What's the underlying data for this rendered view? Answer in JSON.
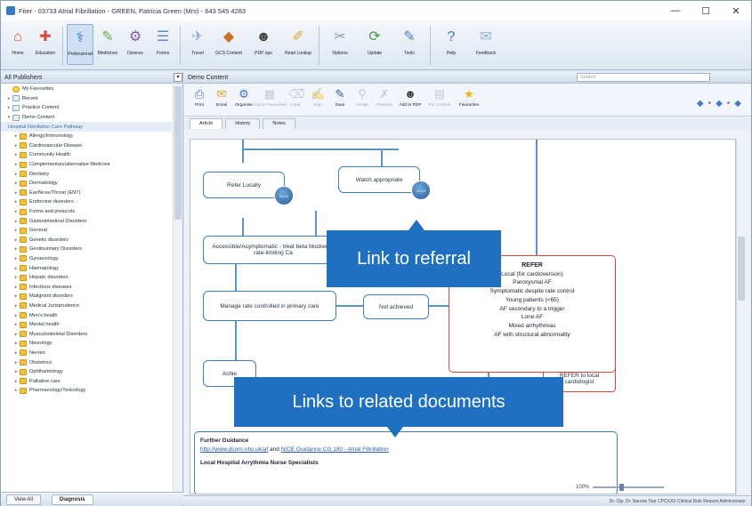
{
  "window": {
    "title": "Fiter - 03733 Atrial Fibrillation  -  GREEN, Patricia Green (Mrs) - 643 545 4283",
    "min": "—",
    "max": "☐",
    "close": "✕"
  },
  "ribbon": {
    "buttons": [
      {
        "label": "Home",
        "icon": "home-icon",
        "color": "#d9483b",
        "glyph": "⌂"
      },
      {
        "label": "Education",
        "icon": "first-aid-icon",
        "color": "#d9483b",
        "glyph": "✚"
      },
      {
        "label": "Professional",
        "icon": "stethoscope-icon",
        "color": "#3a78c8",
        "glyph": "⚕"
      },
      {
        "label": "Medicines",
        "icon": "pills-icon",
        "color": "#6aa84f",
        "glyph": "✎"
      },
      {
        "label": "Devices",
        "icon": "devices-icon",
        "color": "#7a5fa8",
        "glyph": "⚙"
      },
      {
        "label": "Forms",
        "icon": "forms-icon",
        "color": "#5e88c6",
        "glyph": "☰"
      },
      {
        "label": "Travel",
        "icon": "travel-icon",
        "color": "#8db3dd",
        "glyph": "✈"
      },
      {
        "label": "GCS Content",
        "icon": "content-icon",
        "color": "#c8712c",
        "glyph": "◆"
      },
      {
        "label": "PDP ops",
        "icon": "pdp-icon",
        "color": "#444",
        "glyph": "☻"
      },
      {
        "label": "Read Lookup",
        "icon": "lookup-icon",
        "color": "#e0a43a",
        "glyph": "✐"
      },
      {
        "label": "Options",
        "icon": "options-icon",
        "color": "#8a9bb0",
        "glyph": "✂"
      },
      {
        "label": "Update",
        "icon": "update-icon",
        "color": "#4a9a4a",
        "glyph": "⟳"
      },
      {
        "label": "Tools",
        "icon": "tools-icon",
        "color": "#4a7bbf",
        "glyph": "✎"
      },
      {
        "label": "Help",
        "icon": "help-icon",
        "color": "#3a78c8",
        "glyph": "?"
      },
      {
        "label": "Feedback",
        "icon": "feedback-icon",
        "color": "#8db3dd",
        "glyph": "✉"
      }
    ]
  },
  "left": {
    "header": "All Publishers",
    "tree": [
      {
        "label": "My Favourites",
        "type": "star",
        "exp": ""
      },
      {
        "label": "Recent",
        "type": "doc",
        "exp": "▸"
      },
      {
        "label": "Practice Content",
        "type": "doc",
        "exp": "▸"
      },
      {
        "label": "Demo Content",
        "type": "doc",
        "exp": "▾"
      },
      {
        "label": "Hospital Fibrillation Care Pathway",
        "type": "hl",
        "exp": ""
      },
      {
        "label": "Allergy/Immunology",
        "type": "f",
        "exp": "▸"
      },
      {
        "label": "Cardiovascular Disease",
        "type": "f",
        "exp": "▸"
      },
      {
        "label": "Community Health",
        "type": "f",
        "exp": "▸"
      },
      {
        "label": "Complementary/alternative Medicine",
        "type": "f",
        "exp": "▸"
      },
      {
        "label": "Dentistry",
        "type": "f",
        "exp": "▸"
      },
      {
        "label": "Dermatology",
        "type": "f",
        "exp": "▸"
      },
      {
        "label": "Ear/Nose/Throat (ENT)",
        "type": "f",
        "exp": "▸"
      },
      {
        "label": "Endocrine disorders",
        "type": "f",
        "exp": "▸"
      },
      {
        "label": "Forms and protocols",
        "type": "f",
        "exp": "▸"
      },
      {
        "label": "Gastrointestinal Disorders",
        "type": "f",
        "exp": "▸"
      },
      {
        "label": "General",
        "type": "f",
        "exp": "▸"
      },
      {
        "label": "Genetic disorders",
        "type": "f",
        "exp": "▸"
      },
      {
        "label": "Genitourinary Disorders",
        "type": "f",
        "exp": "▸"
      },
      {
        "label": "Gynaecology",
        "type": "f",
        "exp": "▸"
      },
      {
        "label": "Haematology",
        "type": "f",
        "exp": "▸"
      },
      {
        "label": "Hepatic disorders",
        "type": "f",
        "exp": "▸"
      },
      {
        "label": "Infectious diseases",
        "type": "f",
        "exp": "▸"
      },
      {
        "label": "Malignant disorders",
        "type": "f",
        "exp": "▸"
      },
      {
        "label": "Medical Jurisprudence",
        "type": "f",
        "exp": "▸"
      },
      {
        "label": "Men's health",
        "type": "f",
        "exp": "▸"
      },
      {
        "label": "Mental health",
        "type": "f",
        "exp": "▸"
      },
      {
        "label": "Musculoskeletal Disorders",
        "type": "f",
        "exp": "▸"
      },
      {
        "label": "Neurology",
        "type": "f",
        "exp": "▸"
      },
      {
        "label": "Nerves",
        "type": "f",
        "exp": "▸"
      },
      {
        "label": "Obstetrics",
        "type": "f",
        "exp": "▸"
      },
      {
        "label": "Ophthalmology",
        "type": "f",
        "exp": "▸"
      },
      {
        "label": "Palliative care",
        "type": "f",
        "exp": "▸"
      },
      {
        "label": "Pharmacology/Toxicology",
        "type": "f",
        "exp": "▸"
      }
    ],
    "bottom": {
      "view_all": "View All",
      "diagnosis": "Diagnosis"
    }
  },
  "right": {
    "title": "Demo Content",
    "search_placeholder": "Search",
    "toolbar": [
      {
        "label": "Print",
        "glyph": "⎙",
        "color": "#3a78c8",
        "dis": false
      },
      {
        "label": "Email",
        "glyph": "✉",
        "color": "#e0a43a",
        "dis": false
      },
      {
        "label": "Organise",
        "glyph": "⚙",
        "color": "#3a78c8",
        "dis": false
      },
      {
        "label": "Add to Favourites",
        "glyph": "▦",
        "color": "#889",
        "dis": true
      },
      {
        "label": "Clear",
        "glyph": "⌫",
        "color": "#889",
        "dis": true
      },
      {
        "label": "Sign",
        "glyph": "✍",
        "color": "#889",
        "dis": true
      },
      {
        "label": "Save",
        "glyph": "✎",
        "color": "#3a5a9a",
        "dis": false
      },
      {
        "label": "Assign",
        "glyph": "⚲",
        "color": "#889",
        "dis": true
      },
      {
        "label": "Process",
        "glyph": "✗",
        "color": "#889",
        "dis": true
      },
      {
        "label": "Add to PDP",
        "glyph": "☻",
        "color": "#444",
        "dis": false
      },
      {
        "label": "Pin Content",
        "glyph": "▤",
        "color": "#889",
        "dis": true
      },
      {
        "label": "Favourites",
        "glyph": "★",
        "color": "#e8b520",
        "dis": false
      }
    ],
    "tabs": [
      "Article",
      "History",
      "Notes"
    ],
    "nav": "◆•◆•◆",
    "flow": {
      "refer_locally": "Refer Locally",
      "watch_appropriate": "Watch appropriate",
      "accessible_box": "Accessible/Asymptomatic - treat beta blocker or rate-limiting Ca",
      "manage_rate": "Manage rate controlled in primary care",
      "not_achieved": "Not achieved",
      "achieved": "Achie",
      "refer_cardio": "REFER to local cardiologist",
      "circle": "CLICK HERE",
      "refer_title": "REFER",
      "refer_lines": [
        "Local (for cardioversion)",
        "Paroxysmal AF",
        "Symptomatic despite rate control",
        "Young patients (<65)",
        "AF secondary to a trigger",
        "Lone AF",
        "Mixed arrhythmias",
        "AF with structural abnormality"
      ],
      "guide_title": "Further Guidance",
      "guide_link1": "http://www.dcom-nhs.uk/af",
      "guide_and": "and",
      "guide_link2": "NICE Guidance CG 180 - Atrial Fibrillation",
      "guide_sub": "Local Hospital Arrythmia Nurse Specialists"
    },
    "callouts": {
      "referral": "Link to referral",
      "related": "Links to related documents"
    },
    "zoom": "100%",
    "status": "Dr. Ctp. Dr. Narrow Tsar CPCXXX  Clinical Role Reason Administrator"
  }
}
